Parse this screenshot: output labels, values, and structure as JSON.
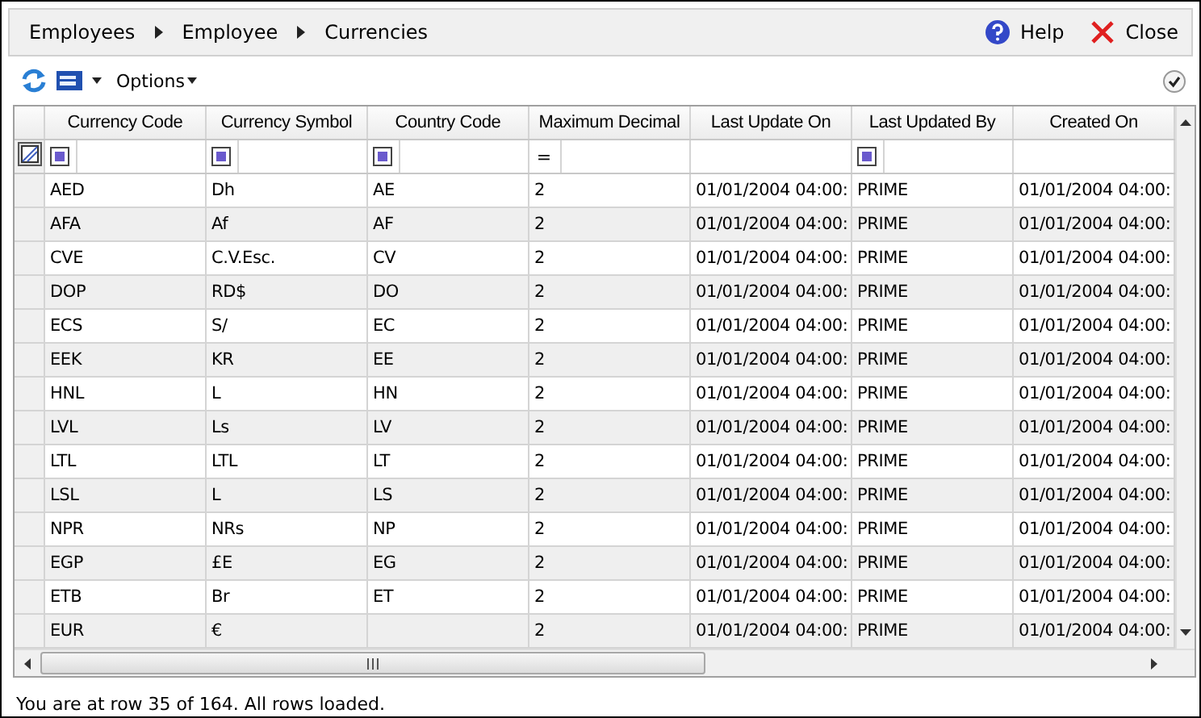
{
  "breadcrumb": [
    "Employees",
    "Employee",
    "Currencies"
  ],
  "header_actions": [
    {
      "kind": "help",
      "label": "Help"
    },
    {
      "kind": "close",
      "label": "Close"
    }
  ],
  "toolbar": {
    "options_label": "Options"
  },
  "table": {
    "columns": [
      "Currency Code",
      "Currency Symbol",
      "Country Code",
      "Maximum Decimal",
      "Last Update On",
      "Last Updated By",
      "Created On"
    ],
    "filters": [
      {
        "kind": "square"
      },
      {
        "kind": "square"
      },
      {
        "kind": "square"
      },
      {
        "kind": "operator",
        "text": "="
      },
      {
        "kind": "none"
      },
      {
        "kind": "square"
      },
      {
        "kind": "none"
      }
    ],
    "rows": [
      [
        "AED",
        "Dh",
        "AE",
        "2",
        "01/01/2004 04:00:",
        "PRIME",
        "01/01/2004 04:00:"
      ],
      [
        "AFA",
        "Af",
        "AF",
        "2",
        "01/01/2004 04:00:",
        "PRIME",
        "01/01/2004 04:00:"
      ],
      [
        "CVE",
        "C.V.Esc.",
        "CV",
        "2",
        "01/01/2004 04:00:",
        "PRIME",
        "01/01/2004 04:00:"
      ],
      [
        "DOP",
        "RD$",
        "DO",
        "2",
        "01/01/2004 04:00:",
        "PRIME",
        "01/01/2004 04:00:"
      ],
      [
        "ECS",
        "S/",
        "EC",
        "2",
        "01/01/2004 04:00:",
        "PRIME",
        "01/01/2004 04:00:"
      ],
      [
        "EEK",
        "KR",
        "EE",
        "2",
        "01/01/2004 04:00:",
        "PRIME",
        "01/01/2004 04:00:"
      ],
      [
        "HNL",
        "L",
        "HN",
        "2",
        "01/01/2004 04:00:",
        "PRIME",
        "01/01/2004 04:00:"
      ],
      [
        "LVL",
        "Ls",
        "LV",
        "2",
        "01/01/2004 04:00:",
        "PRIME",
        "01/01/2004 04:00:"
      ],
      [
        "LTL",
        "LTL",
        "LT",
        "2",
        "01/01/2004 04:00:",
        "PRIME",
        "01/01/2004 04:00:"
      ],
      [
        "LSL",
        "L",
        "LS",
        "2",
        "01/01/2004 04:00:",
        "PRIME",
        "01/01/2004 04:00:"
      ],
      [
        "NPR",
        "NRs",
        "NP",
        "2",
        "01/01/2004 04:00:",
        "PRIME",
        "01/01/2004 04:00:"
      ],
      [
        "EGP",
        "£E",
        "EG",
        "2",
        "01/01/2004 04:00:",
        "PRIME",
        "01/01/2004 04:00:"
      ],
      [
        "ETB",
        "Br",
        "ET",
        "2",
        "01/01/2004 04:00:",
        "PRIME",
        "01/01/2004 04:00:"
      ],
      [
        "EUR",
        "€",
        "",
        "2",
        "01/01/2004 04:00:",
        "PRIME",
        "01/01/2004 04:00:"
      ]
    ]
  },
  "status_bar": "You are at row 35 of 164. All rows loaded."
}
